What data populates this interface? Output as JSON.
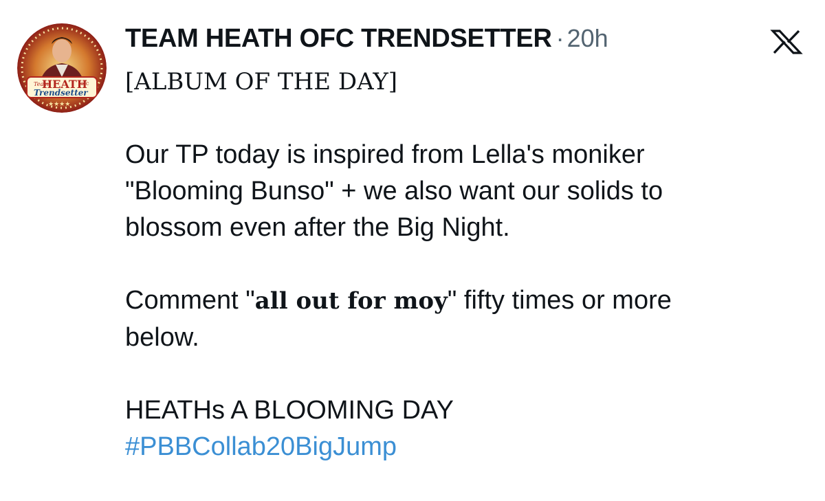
{
  "post": {
    "author": {
      "display_name": "TEAM HEATH OFC TRENDSETTER",
      "avatar_text": {
        "line1": "HEATH",
        "line2": "Trendsetter",
        "badge": "ofc",
        "small": "Team"
      }
    },
    "separator": "·",
    "timestamp": "20h",
    "album_tag": "[ALBUM OF THE DAY]",
    "paragraph1": {
      "line1": "Our TP today is inspired from Lella's moniker",
      "line2": "\"Blooming Bunso\"  + we also want our solids to",
      "line3": "blossom even after the Big Night."
    },
    "paragraph2": {
      "prefix": "Comment \"",
      "emphasis": "all out for moy",
      "suffix": "\" fifty times or more",
      "line2": "below."
    },
    "closing": "HEATHs A BLOOMING DAY",
    "hashtag": "#PBBCollab20BigJump"
  },
  "platform_icon": "x-logo-icon",
  "colors": {
    "text": "#0f1419",
    "muted": "#536471",
    "link": "#3b8fd4",
    "avatar_ring": "#c0392b"
  }
}
